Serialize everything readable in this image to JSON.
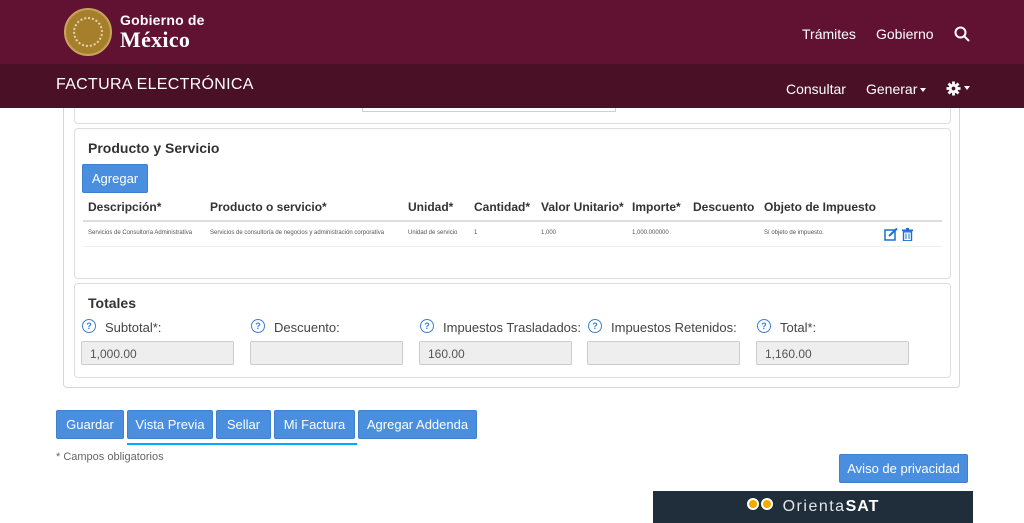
{
  "header": {
    "logo_line1": "Gobierno de",
    "logo_line2": "México",
    "nav": [
      "Trámites",
      "Gobierno"
    ],
    "search_icon": "search-icon"
  },
  "subheader": {
    "title": "FACTURA ELECTRÓNICA",
    "consultar": "Consultar",
    "generar": "Generar",
    "settings_icon": "gear-icon"
  },
  "producto": {
    "title": "Producto y Servicio",
    "add_button": "Agregar",
    "columns": [
      "Descripción*",
      "Producto o servicio*",
      "Unidad*",
      "Cantidad*",
      "Valor Unitario*",
      "Importe*",
      "Descuento",
      "Objeto de Impuesto"
    ],
    "rows": [
      {
        "descripcion": "Servicios de Consultoría Administrativa",
        "producto": "Servicios de consultoría de negocios y administración corporativa",
        "unidad": "Unidad de servicio",
        "cantidad": "1",
        "valor_unitario": "1,000",
        "importe": "1,000.000000",
        "descuento": "",
        "objeto": "Sí objeto de impuesto."
      }
    ],
    "edit_icon": "edit-icon",
    "delete_icon": "trash-icon"
  },
  "totales": {
    "title": "Totales",
    "subtotal_label": "Subtotal*:",
    "subtotal_value": "1,000.00",
    "descuento_label": "Descuento:",
    "descuento_value": "",
    "trasladados_label": "Impuestos Trasladados:",
    "trasladados_value": "160.00",
    "retenidos_label": "Impuestos Retenidos:",
    "retenidos_value": "",
    "total_label": "Total*:",
    "total_value": "1,160.00"
  },
  "actions": {
    "guardar": "Guardar",
    "vista_previa": "Vista Previa",
    "sellar": "Sellar",
    "mi_factura": "Mi Factura",
    "addenda": "Agregar Addenda"
  },
  "footer": {
    "note": "* Campos obligatorios",
    "privacy_button": "Aviso de privacidad",
    "orienta_prefix": "Orienta",
    "orienta_suffix": "SAT"
  }
}
